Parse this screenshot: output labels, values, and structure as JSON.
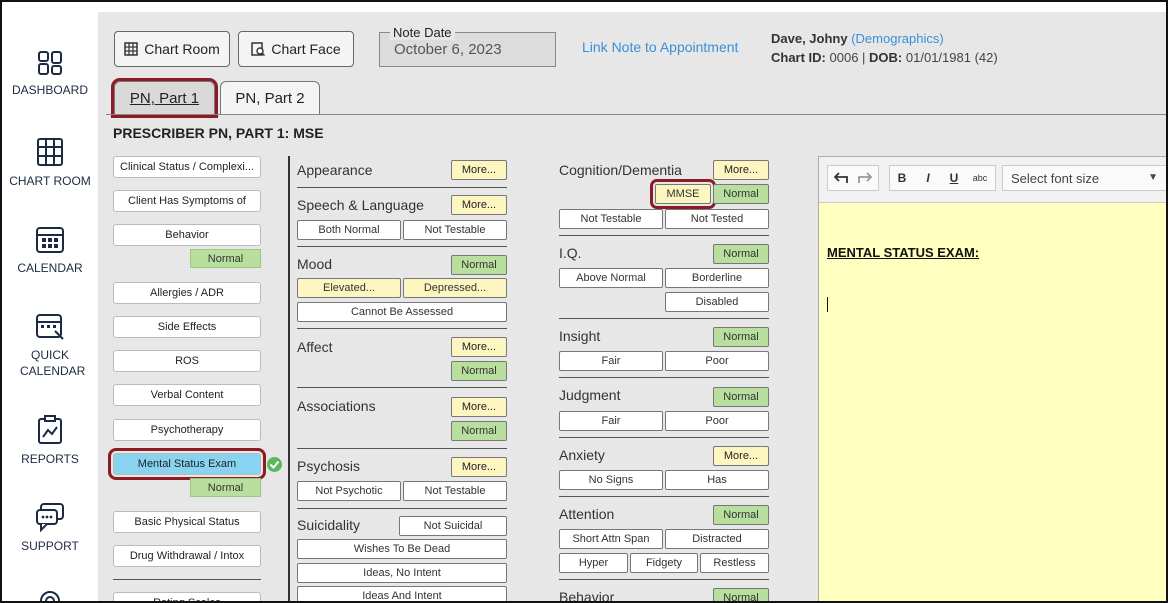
{
  "nav": {
    "items": [
      {
        "label": "DASHBOARD"
      },
      {
        "label": "CHART ROOM"
      },
      {
        "label": "CALENDAR"
      },
      {
        "label": "QUICK CALENDAR"
      },
      {
        "label": "REPORTS"
      },
      {
        "label": "SUPPORT"
      }
    ]
  },
  "header": {
    "chart_room": "Chart Room",
    "chart_face": "Chart Face",
    "note_date_label": "Note Date",
    "note_date_value": "October 6, 2023",
    "link_note": "Link Note to Appointment",
    "patient_name": "Dave, Johny",
    "demographics": "(Demographics)",
    "chart_id_label": "Chart ID:",
    "chart_id": "0006",
    "dob_label": "DOB:",
    "dob": "01/01/1981 (42)"
  },
  "tabs": [
    {
      "label": "PN, Part 1",
      "active": true
    },
    {
      "label": "PN, Part 2",
      "active": false
    }
  ],
  "section_title": "PRESCRIBER PN, PART 1: MSE",
  "left_list": {
    "items": [
      "Clinical Status / Complexi...",
      "Client Has Symptoms of",
      "Behavior",
      "Allergies / ADR",
      "Side Effects",
      "ROS",
      "Verbal Content",
      "Psychotherapy",
      "Mental Status Exam",
      "Basic Physical Status",
      "Drug Withdrawal / Intox",
      "Rating Scales"
    ],
    "normal_label": "Normal"
  },
  "mse": {
    "more": "More...",
    "normal": "Normal",
    "appearance": {
      "title": "Appearance"
    },
    "speech": {
      "title": "Speech & Language",
      "options": [
        "Both Normal",
        "Not Testable"
      ]
    },
    "mood": {
      "title": "Mood",
      "options": [
        "Elevated...",
        "Depressed...",
        "Cannot Be Assessed"
      ]
    },
    "affect": {
      "title": "Affect"
    },
    "associations": {
      "title": "Associations"
    },
    "psychosis": {
      "title": "Psychosis",
      "options": [
        "Not Psychotic",
        "Not Testable"
      ]
    },
    "suicidality": {
      "title": "Suicidality",
      "options": [
        "Not Suicidal",
        "Wishes To Be Dead",
        "Ideas, No Intent",
        "Ideas And Intent"
      ]
    },
    "cognition": {
      "title": "Cognition/Dementia",
      "mmse": "MMSE",
      "options": [
        "Not Testable",
        "Not Tested"
      ]
    },
    "iq": {
      "title": "I.Q.",
      "options": [
        "Above Normal",
        "Borderline",
        "Disabled"
      ]
    },
    "insight": {
      "title": "Insight",
      "options": [
        "Fair",
        "Poor"
      ]
    },
    "judgment": {
      "title": "Judgment",
      "options": [
        "Fair",
        "Poor"
      ]
    },
    "anxiety": {
      "title": "Anxiety",
      "options": [
        "No Signs",
        "Has"
      ]
    },
    "attention": {
      "title": "Attention",
      "options": [
        "Short Attn Span",
        "Distracted",
        "Hyper",
        "Fidgety",
        "Restless"
      ]
    },
    "behavior": {
      "title": "Behavior"
    }
  },
  "editor": {
    "font_size_placeholder": "Select font size",
    "heading": "MENTAL STATUS EXAM:",
    "tools": {
      "bold": "B",
      "italic": "I",
      "underline": "U",
      "strike": "abc"
    }
  },
  "colors": {
    "highlight": "#8b1c24",
    "normal_green": "#b9df9f",
    "more_yellow": "#fdf6c0",
    "selected_blue": "#88d3f0",
    "editor_bg": "#ffffc0",
    "link_blue": "#3a8fd8"
  }
}
